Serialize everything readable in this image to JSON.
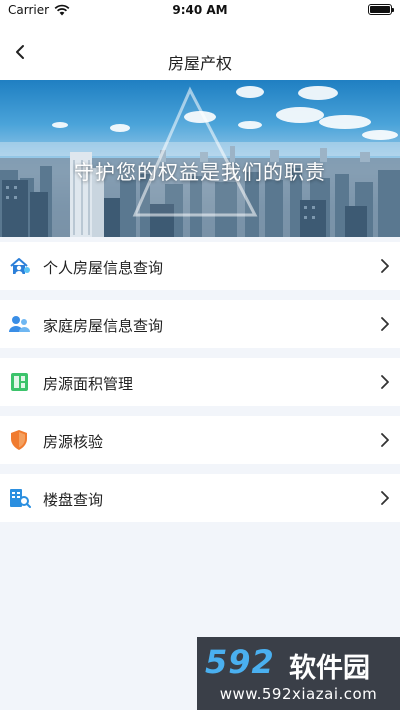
{
  "status_bar": {
    "carrier": "Carrier",
    "time": "9:40 AM",
    "battery_level": 1.0
  },
  "nav": {
    "title": "房屋产权",
    "back_icon": "chevron-left-icon"
  },
  "banner": {
    "slogan": "守护您的权益是我们的职责"
  },
  "menu": {
    "items": [
      {
        "label": "个人房屋信息查询",
        "icon": "house-person-icon",
        "color": "#2b7fd9"
      },
      {
        "label": "家庭房屋信息查询",
        "icon": "family-icon",
        "color": "#3a8ee6"
      },
      {
        "label": "房源面积管理",
        "icon": "area-grid-icon",
        "color": "#3cc36b"
      },
      {
        "label": "房源核验",
        "icon": "shield-check-icon",
        "color": "#f07b2f"
      },
      {
        "label": "楼盘查询",
        "icon": "building-search-icon",
        "color": "#2b8fe0"
      }
    ]
  },
  "watermark": {
    "logo_number": "592",
    "logo_text": "软件园",
    "url": "www.592xiazai.com"
  }
}
